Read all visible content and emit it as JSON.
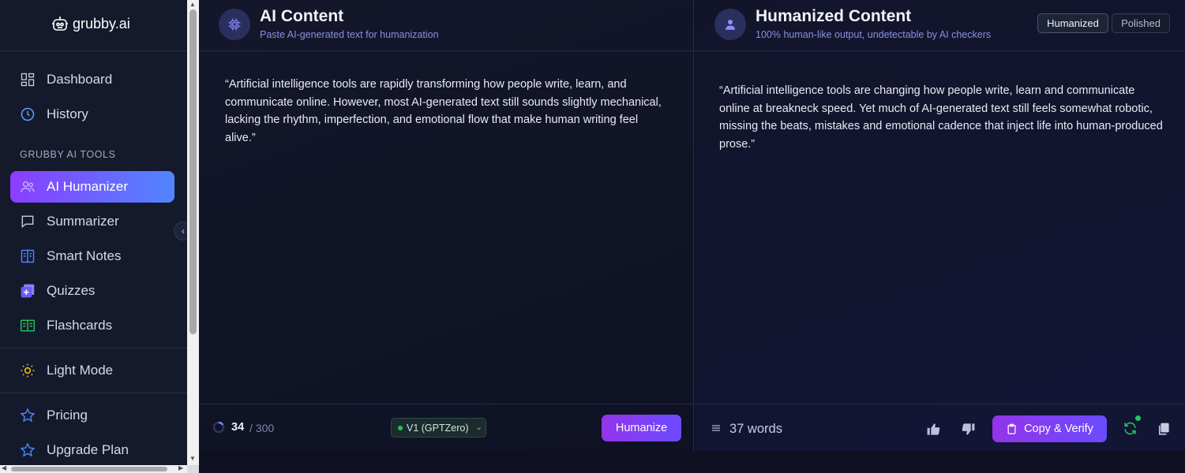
{
  "sidebar": {
    "logo_text": "grubby.ai",
    "items_top": [
      {
        "label": "Dashboard",
        "icon": "dashboard-icon"
      },
      {
        "label": "History",
        "icon": "clock-icon"
      }
    ],
    "section_label": "GRUBBY AI TOOLS",
    "tools": [
      {
        "label": "AI Humanizer",
        "icon": "users-icon",
        "active": true
      },
      {
        "label": "Summarizer",
        "icon": "chat-bubble-icon"
      },
      {
        "label": "Smart Notes",
        "icon": "book-icon"
      },
      {
        "label": "Quizzes",
        "icon": "quiz-plus-icon"
      },
      {
        "label": "Flashcards",
        "icon": "flashcard-icon"
      }
    ],
    "light_mode_label": "Light Mode",
    "pricing_label": "Pricing",
    "upgrade_label": "Upgrade Plan"
  },
  "input_panel": {
    "title": "AI Content",
    "subtitle": "Paste AI-generated text for humanization",
    "text": "“Artificial intelligence tools are rapidly transforming how people write, learn, and communicate online. However, most AI-generated text still sounds slightly mechanical, lacking the rhythm, imperfection, and emotional flow that make human writing feel alive.”",
    "char_count": "34",
    "char_limit": "/ 300",
    "model_select": "V1 (GPTZero)",
    "humanize_button": "Humanize"
  },
  "output_panel": {
    "title": "Humanized Content",
    "subtitle": "100% human-like output, undetectable by AI checkers",
    "mode_humanized": "Humanized",
    "mode_polished": "Polished",
    "text": "“Artificial intelligence tools are changing how people write, learn and communicate online at breakneck speed. Yet much of AI-generated text still feels somewhat robotic, missing the beats, mistakes and emotional cadence that inject life into human-produced prose.”",
    "word_count": "37 words",
    "copy_button": "Copy & Verify"
  },
  "colors": {
    "accent_purple": "#9334ea",
    "accent_blue": "#4f86ff",
    "success_green": "#22c55e",
    "background": "#0f1022"
  }
}
